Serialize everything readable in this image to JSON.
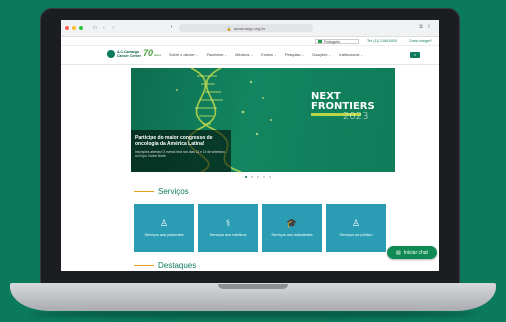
{
  "browser": {
    "url": "accamargo.org.br",
    "traffic_lights": [
      "#ff5f57",
      "#febc2e",
      "#28c840"
    ]
  },
  "utility": {
    "language": "Português",
    "phone": "Tel: (11) 2189-5000",
    "help": "Como chegar?"
  },
  "brand": {
    "name_line1": "A.C.Camargo",
    "name_line2": "Cancer Center",
    "anniversary": "70",
    "anniversary_suffix": "anos"
  },
  "nav": {
    "items": [
      "Sobre o câncer",
      "Pacientes",
      "Médicos",
      "Ensino",
      "Pesquisa",
      "Doações",
      "Institucional"
    ]
  },
  "hero": {
    "caption_title": "Participe do maior congresso de oncologia da América Latina!",
    "caption_body": "Inscrições abertas! O evento terá nos dias 13 e 14 de setembro no Expo Center Norte",
    "brand_line1": "NEXT",
    "brand_line2": "FRONTIERS",
    "year": "2023",
    "active_slide": 1,
    "slides": 5
  },
  "services": {
    "title": "Serviços",
    "cards": [
      {
        "label": "Serviços aos pacientes",
        "icon": "patient-icon"
      },
      {
        "label": "Serviços aos médicos",
        "icon": "doctor-icon"
      },
      {
        "label": "Serviços aos estudantes",
        "icon": "student-icon"
      },
      {
        "label": "Serviços ao público",
        "icon": "public-icon"
      }
    ]
  },
  "highlights": {
    "title": "Destaques"
  },
  "chat": {
    "label": "Iniciar chat"
  },
  "colors": {
    "brand_green": "#0b7a5c",
    "card_blue": "#2a9db4",
    "accent_orange": "#e3a21a",
    "chat_green": "#0f8a55"
  }
}
